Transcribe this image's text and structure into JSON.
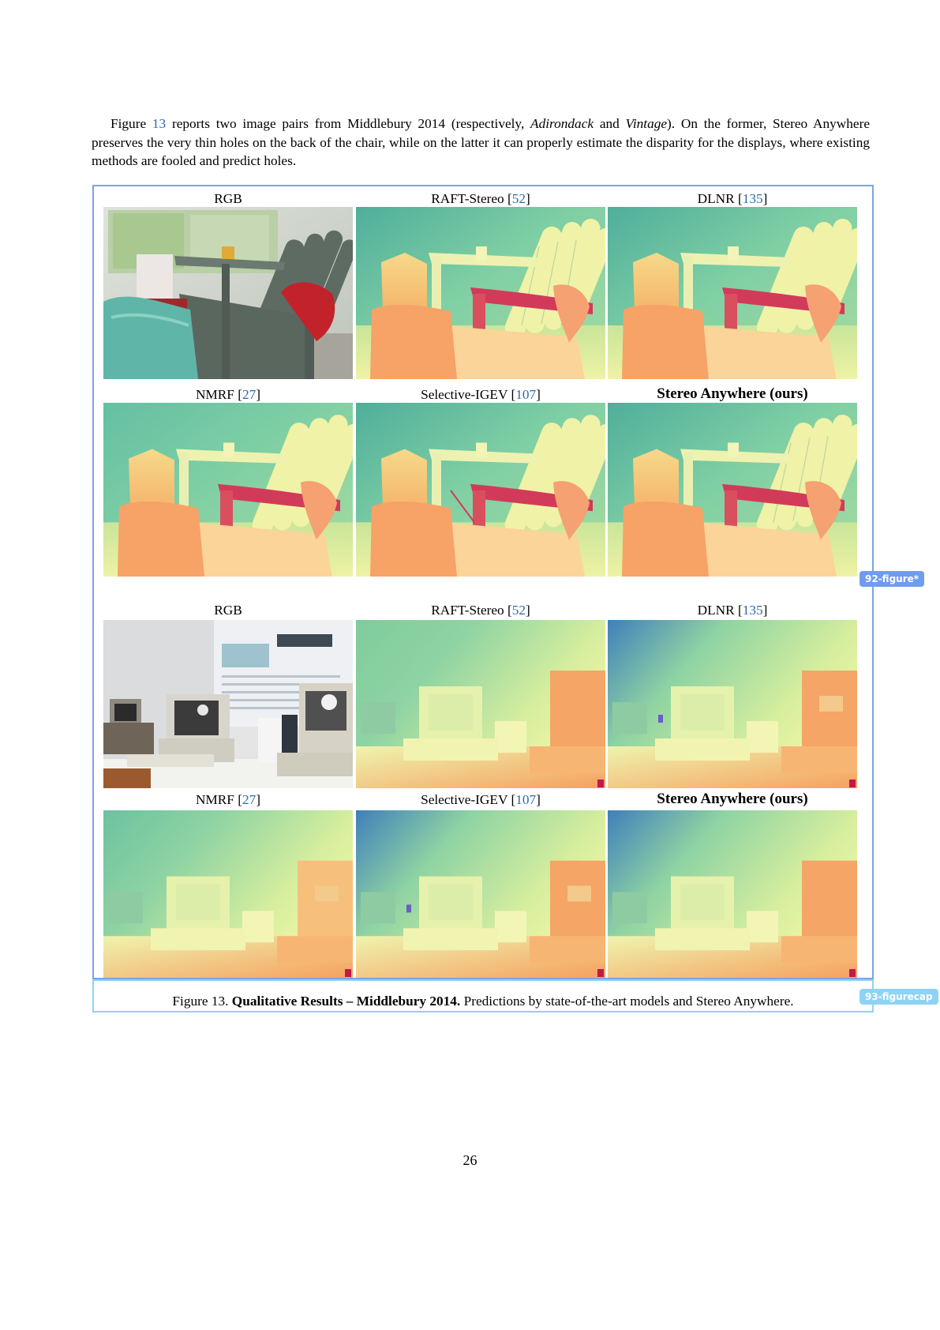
{
  "paragraph": {
    "fig_word": "Figure",
    "fig_ref": "13",
    "text_a": " reports two image pairs from Middlebury 2014 (respectively, ",
    "scene1": "Adirondack",
    "text_and": " and ",
    "scene2": "Vintage",
    "text_b": "). On the former, Stereo Anywhere preserves the very thin holes on the back of the chair, while on the latter it can properly estimate the disparity for the displays, where existing methods are fooled and predict holes."
  },
  "figure": {
    "tag": "92-figure*",
    "groups": [
      {
        "scene": "adirondack",
        "rows": [
          [
            {
              "name": "RGB",
              "ref": ""
            },
            {
              "name": "RAFT-Stereo",
              "ref": "52"
            },
            {
              "name": "DLNR",
              "ref": "135"
            }
          ],
          [
            {
              "name": "NMRF",
              "ref": "27"
            },
            {
              "name": "Selective-IGEV",
              "ref": "107"
            },
            {
              "name": "Stereo Anywhere (ours)",
              "ref": ""
            }
          ]
        ]
      },
      {
        "scene": "vintage",
        "rows": [
          [
            {
              "name": "RGB",
              "ref": ""
            },
            {
              "name": "RAFT-Stereo",
              "ref": "52"
            },
            {
              "name": "DLNR",
              "ref": "135"
            }
          ],
          [
            {
              "name": "NMRF",
              "ref": "27"
            },
            {
              "name": "Selective-IGEV",
              "ref": "107"
            },
            {
              "name": "Stereo Anywhere (ours)",
              "ref": ""
            }
          ]
        ]
      }
    ]
  },
  "caption": {
    "tag": "93-figurecap",
    "prefix": "Figure 13.",
    "bold": "Qualitative Results – Middlebury 2014.",
    "rest": " Predictions by state-of-the-art models and Stereo Anywhere."
  },
  "page_number": "26",
  "colors": {
    "link": "#2e6aa8",
    "figure_frame": "#7ea2e6",
    "caption_frame": "#8fd3f4"
  }
}
